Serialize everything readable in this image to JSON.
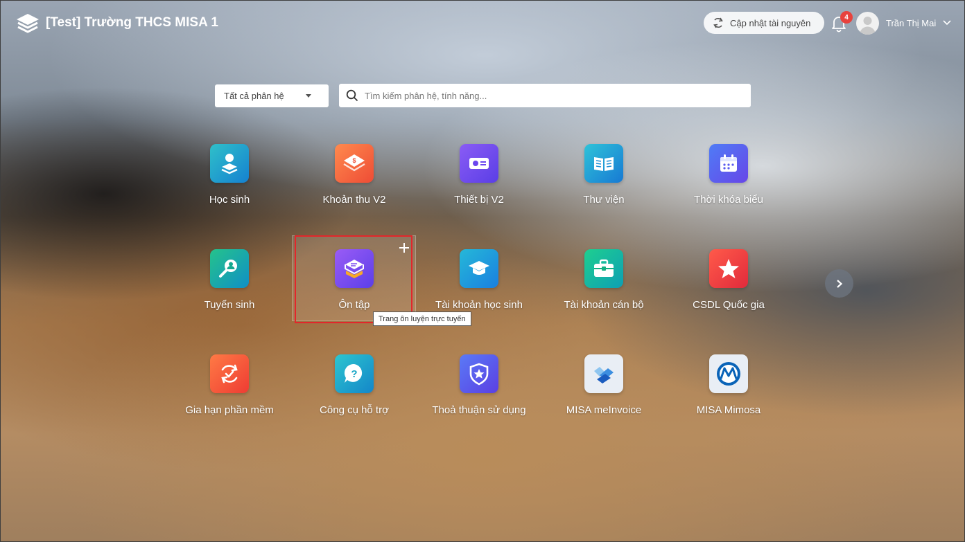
{
  "header": {
    "school_name": "[Test] Trường THCS MISA 1",
    "sync_label": "Cập nhật tài nguyên",
    "notification_count": "4",
    "user_name": "Trần Thị Mai"
  },
  "search": {
    "filter_value": "Tất cả phân hệ",
    "placeholder": "Tìm kiếm phân hệ, tính năng..."
  },
  "modules": [
    {
      "label": "Học sinh",
      "icon": "student-icon",
      "color": "#19a7c8"
    },
    {
      "label": "Khoản thu V2",
      "icon": "fee-icon",
      "color": "#f26a3e"
    },
    {
      "label": "Thiết bị V2",
      "icon": "projector-icon",
      "color": "#6c4ef2"
    },
    {
      "label": "Thư viện",
      "icon": "book-icon",
      "color": "#1e9ed6"
    },
    {
      "label": "Thời khóa biểu",
      "icon": "calendar-icon",
      "color": "#5468f0"
    },
    {
      "label": "Tuyển sinh",
      "icon": "search-person-icon",
      "color": "#14a88f"
    },
    {
      "label": "Ôn tập",
      "icon": "review-icon",
      "color": "#7b4cf0"
    },
    {
      "label": "Tài khoản học sinh",
      "icon": "graduation-cap-icon",
      "color": "#16a2d6"
    },
    {
      "label": "Tài khoản cán bộ",
      "icon": "briefcase-icon",
      "color": "#13b083"
    },
    {
      "label": "CSDL Quốc gia",
      "icon": "star-icon",
      "color": "#ef3b3b"
    },
    {
      "label": "Gia hạn phần mềm",
      "icon": "renew-icon",
      "color": "#f2543b"
    },
    {
      "label": "Công cụ hỗ trợ",
      "icon": "help-icon",
      "color": "#18a6c6"
    },
    {
      "label": "Thoả thuận sử dụng",
      "icon": "shield-star-icon",
      "color": "#5456ee"
    },
    {
      "label": "MISA meInvoice",
      "icon": "meinvoice-icon",
      "color": "#e9eef5"
    },
    {
      "label": "MISA Mimosa",
      "icon": "mimosa-icon",
      "color": "#e9eef5"
    }
  ],
  "tooltip": "Trang ôn luyện trực tuyến"
}
